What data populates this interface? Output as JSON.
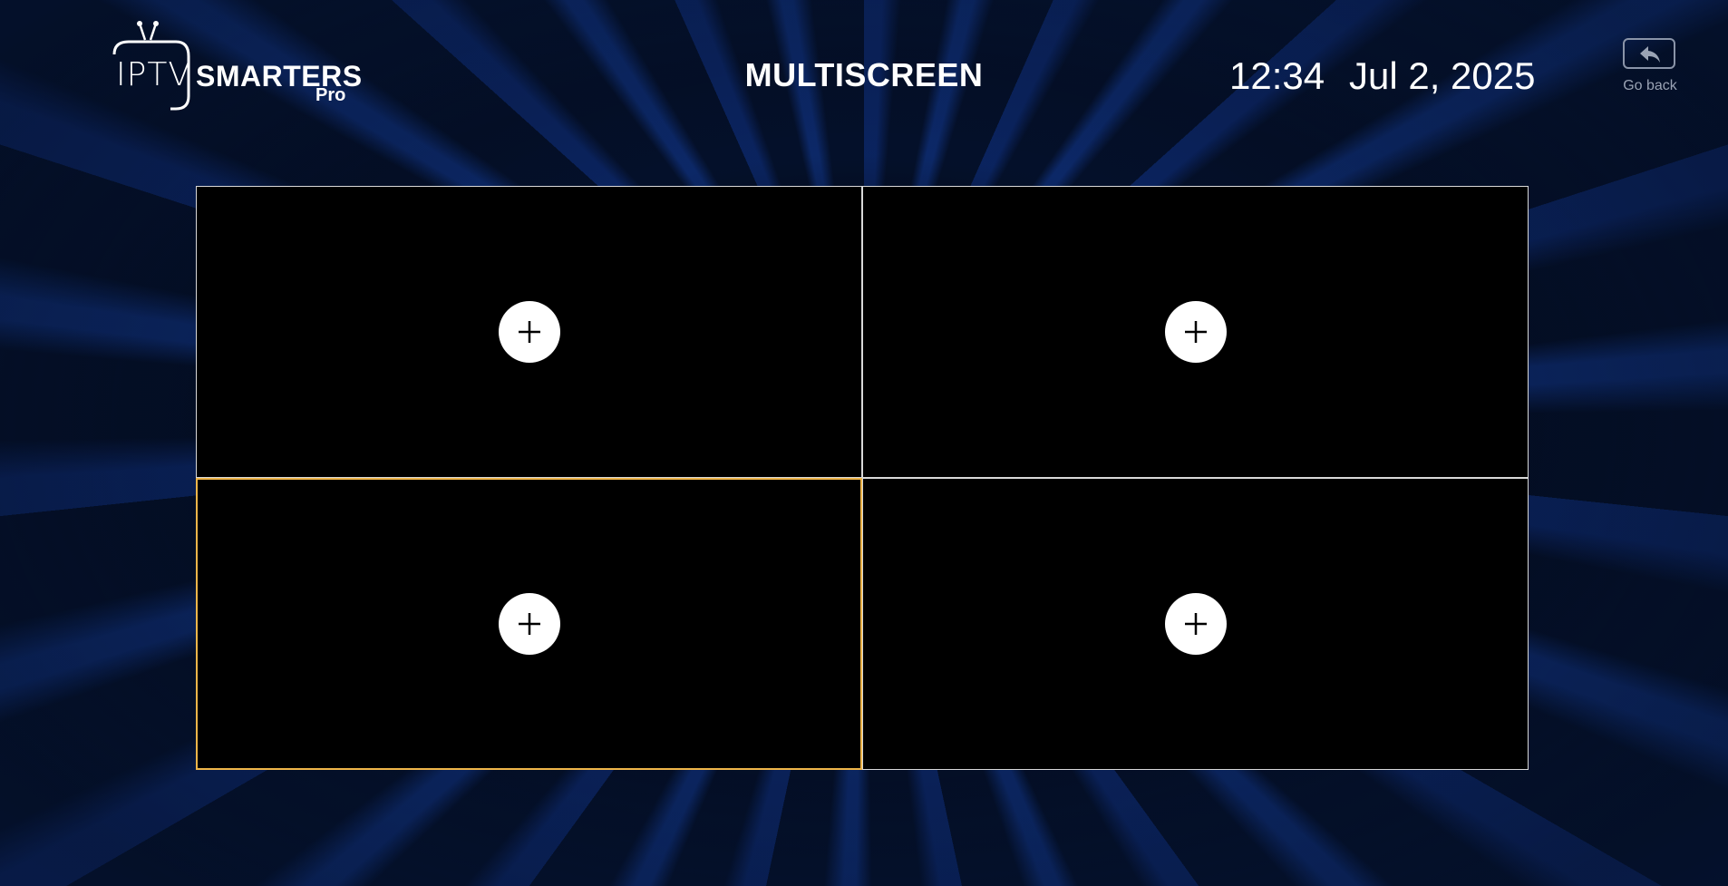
{
  "header": {
    "logo": {
      "iptv": "IPTV",
      "smarters": "SMARTERS",
      "pro": "Pro"
    },
    "title": "MULTISCREEN",
    "time": "12:34",
    "date": "Jul 2, 2025",
    "go_back": {
      "label": "Go back",
      "icon": "reply-arrow-icon"
    }
  },
  "multiscreen": {
    "layout": "2x2",
    "selected_index": 2,
    "screens": [
      {
        "icon": "add-icon"
      },
      {
        "icon": "add-icon"
      },
      {
        "icon": "add-icon"
      },
      {
        "icon": "add-icon"
      }
    ]
  },
  "colors": {
    "background": "#04102a",
    "accent_beams": "#1646b4",
    "cell_background": "#000000",
    "cell_border": "#d9d9d9",
    "selected_border": "#f0b64a",
    "add_button": "#ffffff",
    "text": "#ffffff",
    "muted_text": "#9aa3b4"
  }
}
